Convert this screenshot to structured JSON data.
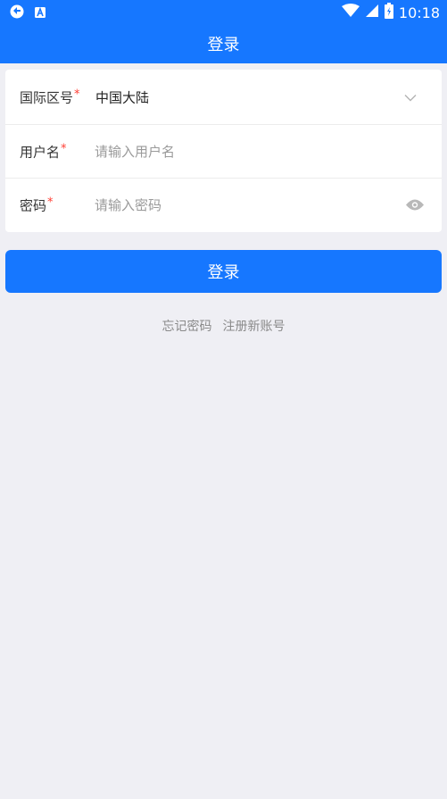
{
  "status_bar": {
    "time": "10:18",
    "icons": [
      "sync-icon",
      "a-badge-icon",
      "wifi-icon",
      "cell-signal-icon",
      "battery-icon"
    ]
  },
  "nav": {
    "title": "登录"
  },
  "form": {
    "region_label": "国际区号",
    "region_value": "中国大陆",
    "username_label": "用户名",
    "username_placeholder": "请输入用户名",
    "password_label": "密码",
    "password_placeholder": "请输入密码",
    "required_mark": "*"
  },
  "login_button": "登录",
  "links": {
    "forgot": "忘记密码",
    "register": "注册新账号"
  },
  "colors": {
    "primary": "#1677ff",
    "background": "#efeff4",
    "required": "#ff3b30"
  }
}
